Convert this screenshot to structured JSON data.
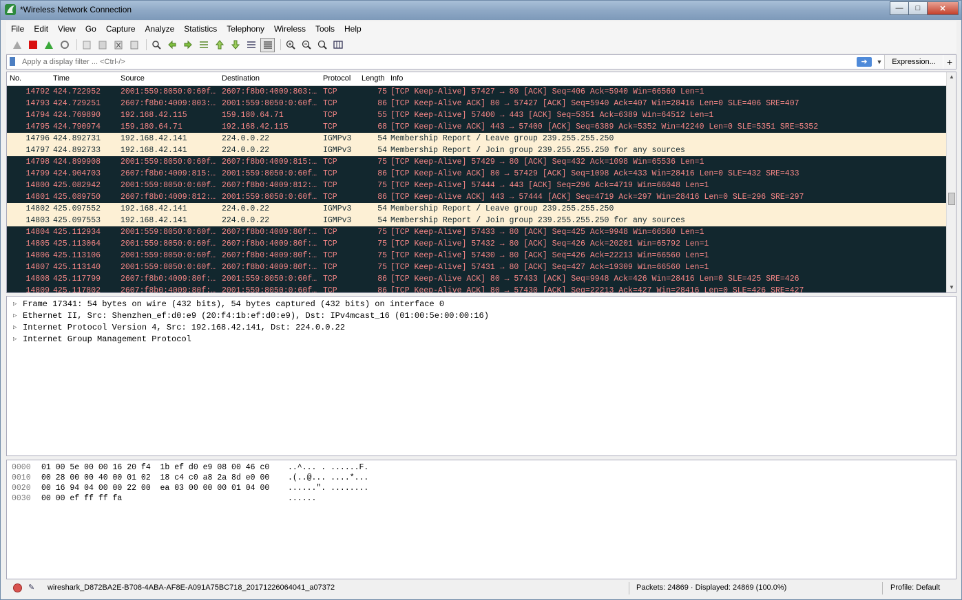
{
  "window": {
    "title": "*Wireless Network Connection"
  },
  "menu": [
    "File",
    "Edit",
    "View",
    "Go",
    "Capture",
    "Analyze",
    "Statistics",
    "Telephony",
    "Wireless",
    "Tools",
    "Help"
  ],
  "toolbar": {
    "buttons": [
      "shark-fin-start-icon",
      "stop-capture-icon",
      "restart-capture-icon",
      "capture-options-icon",
      "open-file-icon",
      "save-file-icon",
      "close-file-icon",
      "reload-file-icon",
      "find-packet-icon",
      "go-back-icon",
      "go-forward-icon",
      "go-to-packet-icon",
      "go-first-icon",
      "go-last-icon",
      "auto-scroll-icon",
      "colorize-icon",
      "zoom-in-icon",
      "zoom-out-icon",
      "normal-size-icon",
      "resize-columns-icon"
    ]
  },
  "filter": {
    "placeholder": "Apply a display filter ... <Ctrl-/>",
    "value": "",
    "expression_label": "Expression...",
    "plus_label": "+"
  },
  "columns": {
    "no": "No.",
    "time": "Time",
    "source": "Source",
    "destination": "Destination",
    "protocol": "Protocol",
    "length": "Length",
    "info": "Info"
  },
  "packets": [
    {
      "no": "14792",
      "time": "424.722952",
      "src": "2001:559:8050:0:60f…",
      "dst": "2607:f8b0:4009:803:…",
      "proto": "TCP",
      "len": "75",
      "info": "[TCP Keep-Alive] 57427 → 80 [ACK] Seq=406 Ack=5940 Win=66560 Len=1",
      "style": "dark"
    },
    {
      "no": "14793",
      "time": "424.729251",
      "src": "2607:f8b0:4009:803:…",
      "dst": "2001:559:8050:0:60f…",
      "proto": "TCP",
      "len": "86",
      "info": "[TCP Keep-Alive ACK] 80 → 57427 [ACK] Seq=5940 Ack=407 Win=28416 Len=0 SLE=406 SRE=407",
      "style": "dark"
    },
    {
      "no": "14794",
      "time": "424.769890",
      "src": "192.168.42.115",
      "dst": "159.180.64.71",
      "proto": "TCP",
      "len": "55",
      "info": "[TCP Keep-Alive] 57400 → 443 [ACK] Seq=5351 Ack=6389 Win=64512 Len=1",
      "style": "dark"
    },
    {
      "no": "14795",
      "time": "424.790974",
      "src": "159.180.64.71",
      "dst": "192.168.42.115",
      "proto": "TCP",
      "len": "68",
      "info": "[TCP Keep-Alive ACK] 443 → 57400 [ACK] Seq=6389 Ack=5352 Win=42240 Len=0 SLE=5351 SRE=5352",
      "style": "dark"
    },
    {
      "no": "14796",
      "time": "424.892731",
      "src": "192.168.42.141",
      "dst": "224.0.0.22",
      "proto": "IGMPv3",
      "len": "54",
      "info": "Membership Report / Leave group 239.255.255.250",
      "style": "light"
    },
    {
      "no": "14797",
      "time": "424.892733",
      "src": "192.168.42.141",
      "dst": "224.0.0.22",
      "proto": "IGMPv3",
      "len": "54",
      "info": "Membership Report / Join group 239.255.255.250 for any sources",
      "style": "light"
    },
    {
      "no": "14798",
      "time": "424.899908",
      "src": "2001:559:8050:0:60f…",
      "dst": "2607:f8b0:4009:815:…",
      "proto": "TCP",
      "len": "75",
      "info": "[TCP Keep-Alive] 57429 → 80 [ACK] Seq=432 Ack=1098 Win=65536 Len=1",
      "style": "dark"
    },
    {
      "no": "14799",
      "time": "424.904703",
      "src": "2607:f8b0:4009:815:…",
      "dst": "2001:559:8050:0:60f…",
      "proto": "TCP",
      "len": "86",
      "info": "[TCP Keep-Alive ACK] 80 → 57429 [ACK] Seq=1098 Ack=433 Win=28416 Len=0 SLE=432 SRE=433",
      "style": "dark"
    },
    {
      "no": "14800",
      "time": "425.082942",
      "src": "2001:559:8050:0:60f…",
      "dst": "2607:f8b0:4009:812:…",
      "proto": "TCP",
      "len": "75",
      "info": "[TCP Keep-Alive] 57444 → 443 [ACK] Seq=296 Ack=4719 Win=66048 Len=1",
      "style": "dark"
    },
    {
      "no": "14801",
      "time": "425.089750",
      "src": "2607:f8b0:4009:812:…",
      "dst": "2001:559:8050:0:60f…",
      "proto": "TCP",
      "len": "86",
      "info": "[TCP Keep-Alive ACK] 443 → 57444 [ACK] Seq=4719 Ack=297 Win=28416 Len=0 SLE=296 SRE=297",
      "style": "dark"
    },
    {
      "no": "14802",
      "time": "425.097552",
      "src": "192.168.42.141",
      "dst": "224.0.0.22",
      "proto": "IGMPv3",
      "len": "54",
      "info": "Membership Report / Leave group 239.255.255.250",
      "style": "light"
    },
    {
      "no": "14803",
      "time": "425.097553",
      "src": "192.168.42.141",
      "dst": "224.0.0.22",
      "proto": "IGMPv3",
      "len": "54",
      "info": "Membership Report / Join group 239.255.255.250 for any sources",
      "style": "light"
    },
    {
      "no": "14804",
      "time": "425.112934",
      "src": "2001:559:8050:0:60f…",
      "dst": "2607:f8b0:4009:80f:…",
      "proto": "TCP",
      "len": "75",
      "info": "[TCP Keep-Alive] 57433 → 80 [ACK] Seq=425 Ack=9948 Win=66560 Len=1",
      "style": "dark"
    },
    {
      "no": "14805",
      "time": "425.113064",
      "src": "2001:559:8050:0:60f…",
      "dst": "2607:f8b0:4009:80f:…",
      "proto": "TCP",
      "len": "75",
      "info": "[TCP Keep-Alive] 57432 → 80 [ACK] Seq=426 Ack=20201 Win=65792 Len=1",
      "style": "dark"
    },
    {
      "no": "14806",
      "time": "425.113106",
      "src": "2001:559:8050:0:60f…",
      "dst": "2607:f8b0:4009:80f:…",
      "proto": "TCP",
      "len": "75",
      "info": "[TCP Keep-Alive] 57430 → 80 [ACK] Seq=426 Ack=22213 Win=66560 Len=1",
      "style": "dark"
    },
    {
      "no": "14807",
      "time": "425.113140",
      "src": "2001:559:8050:0:60f…",
      "dst": "2607:f8b0:4009:80f:…",
      "proto": "TCP",
      "len": "75",
      "info": "[TCP Keep-Alive] 57431 → 80 [ACK] Seq=427 Ack=19309 Win=66560 Len=1",
      "style": "dark"
    },
    {
      "no": "14808",
      "time": "425.117799",
      "src": "2607:f8b0:4009:80f:…",
      "dst": "2001:559:8050:0:60f…",
      "proto": "TCP",
      "len": "86",
      "info": "[TCP Keep-Alive ACK] 80 → 57433 [ACK] Seq=9948 Ack=426 Win=28416 Len=0 SLE=425 SRE=426",
      "style": "dark"
    },
    {
      "no": "14809",
      "time": "425.117802",
      "src": "2607:f8b0:4009:80f:…",
      "dst": "2001:559:8050:0:60f…",
      "proto": "TCP",
      "len": "86",
      "info": "[TCP Keep-Alive ACK] 80 → 57430 [ACK] Seq=22213 Ack=427 Win=28416 Len=0 SLE=426 SRE=427",
      "style": "dark"
    }
  ],
  "details": [
    "Frame 17341: 54 bytes on wire (432 bits), 54 bytes captured (432 bits) on interface 0",
    "Ethernet II, Src: Shenzhen_ef:d0:e9 (20:f4:1b:ef:d0:e9), Dst: IPv4mcast_16 (01:00:5e:00:00:16)",
    "Internet Protocol Version 4, Src: 192.168.42.141, Dst: 224.0.0.22",
    "Internet Group Management Protocol"
  ],
  "bytes": [
    {
      "offset": "0000",
      "hex": "01 00 5e 00 00 16 20 f4  1b ef d0 e9 08 00 46 c0",
      "ascii": "..^... . ......F."
    },
    {
      "offset": "0010",
      "hex": "00 28 00 00 40 00 01 02  18 c4 c0 a8 2a 8d e0 00",
      "ascii": ".(..@... ....*..."
    },
    {
      "offset": "0020",
      "hex": "00 16 94 04 00 00 22 00  ea 03 00 00 00 01 04 00",
      "ascii": "......\". ........"
    },
    {
      "offset": "0030",
      "hex": "00 00 ef ff ff fa",
      "ascii": "......"
    }
  ],
  "status": {
    "file": "wireshark_D872BA2E-B708-4ABA-AF8E-A091A75BC718_20171226064041_a07372",
    "packets": "Packets: 24869 · Displayed: 24869 (100.0%)",
    "profile": "Profile: Default"
  },
  "colors": {
    "tcp_row_bg": "#12272e",
    "tcp_row_fg": "#f78787",
    "igmp_row_bg": "#fdf0d5"
  }
}
